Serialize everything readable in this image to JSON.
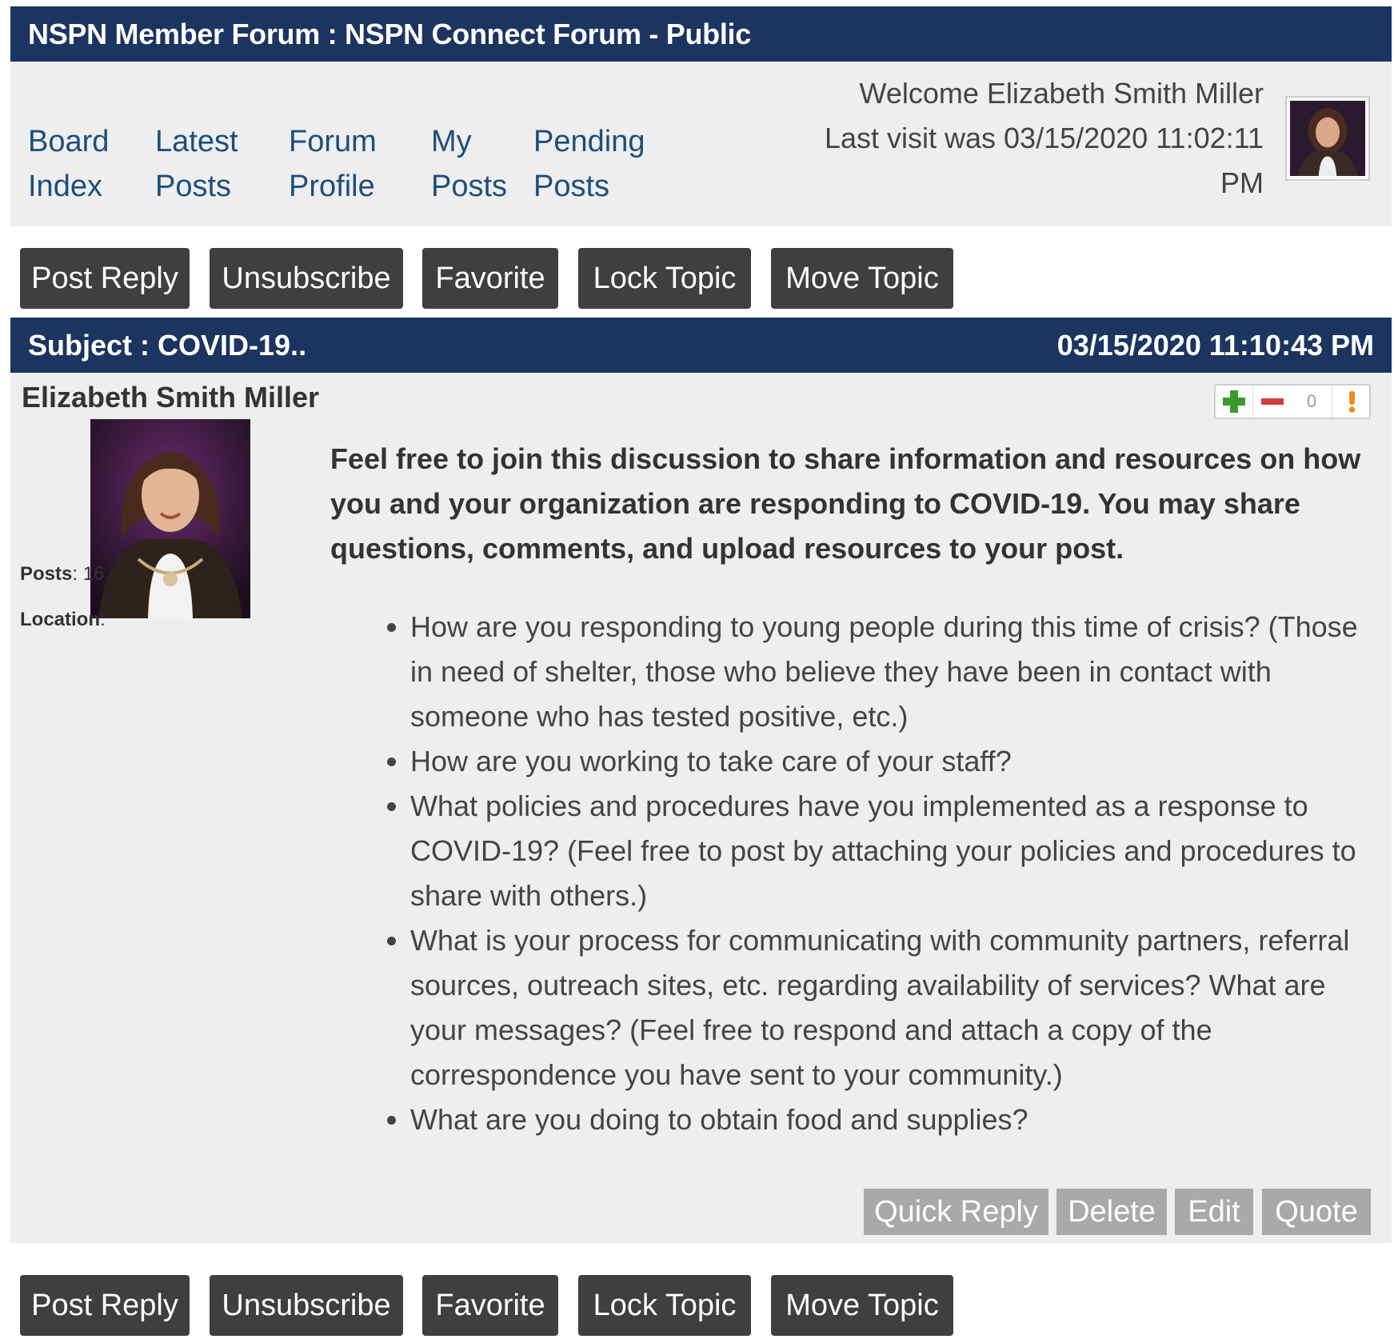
{
  "header": {
    "title": "NSPN Member Forum : NSPN Connect Forum - Public"
  },
  "nav": {
    "links": [
      {
        "line1": "Board",
        "line2": "Index"
      },
      {
        "line1": "Latest",
        "line2": "Posts"
      },
      {
        "line1": "Forum",
        "line2": "Profile"
      },
      {
        "line1": "My",
        "line2": "Posts"
      },
      {
        "line1": "Pending",
        "line2": "Posts"
      }
    ],
    "welcome": "Welcome Elizabeth Smith Miller",
    "last_visit_line1": "Last visit was 03/15/2020 11:02:11",
    "last_visit_line2": "PM"
  },
  "topic_buttons": {
    "post_reply": "Post Reply",
    "unsubscribe": "Unsubscribe",
    "favorite": "Favorite",
    "lock_topic": "Lock Topic",
    "move_topic": "Move Topic"
  },
  "post": {
    "subject": "Subject : COVID-19..",
    "date": "03/15/2020 11:10:43 PM",
    "author": "Elizabeth Smith Miller",
    "posts_label": "Posts",
    "posts_value": ": 16",
    "location_label": "Location",
    "location_value": ":",
    "rating": {
      "plus_icon": "plus-icon",
      "minus_icon": "minus-icon",
      "count": "0",
      "report_icon": "exclamation-icon"
    },
    "intro": "Feel free to join this discussion to share information and resources on how you and your organization are responding to COVID-19. You may share questions, comments, and upload resources to your post.",
    "bullets": [
      "How are you responding to young people during this time of crisis? (Those in need of shelter, those who believe they have been in contact with someone who has tested positive, etc.)",
      "How are you working to take care of your staff?",
      "What policies and procedures have you implemented as a response to COVID-19? (Feel free to post by attaching your policies and procedures to share with others.)",
      "What is your process for communicating with community partners, referral sources, outreach sites, etc. regarding availability of services? What are your messages? (Feel free to respond and attach a copy of the correspondence you have sent to your community.)",
      "What are you doing to obtain food and supplies?"
    ],
    "actions": {
      "quick_reply": "Quick Reply",
      "delete": "Delete",
      "edit": "Edit",
      "quote": "Quote"
    }
  },
  "colors": {
    "header_bg": "#1c3560",
    "panel_bg": "#eeeeee",
    "link": "#1f4e79",
    "dark_button": "#3f3f3f",
    "light_button": "#a9a9a9",
    "plus": "#3a9a2c",
    "minus": "#d13f3f",
    "report": "#f08a24"
  }
}
